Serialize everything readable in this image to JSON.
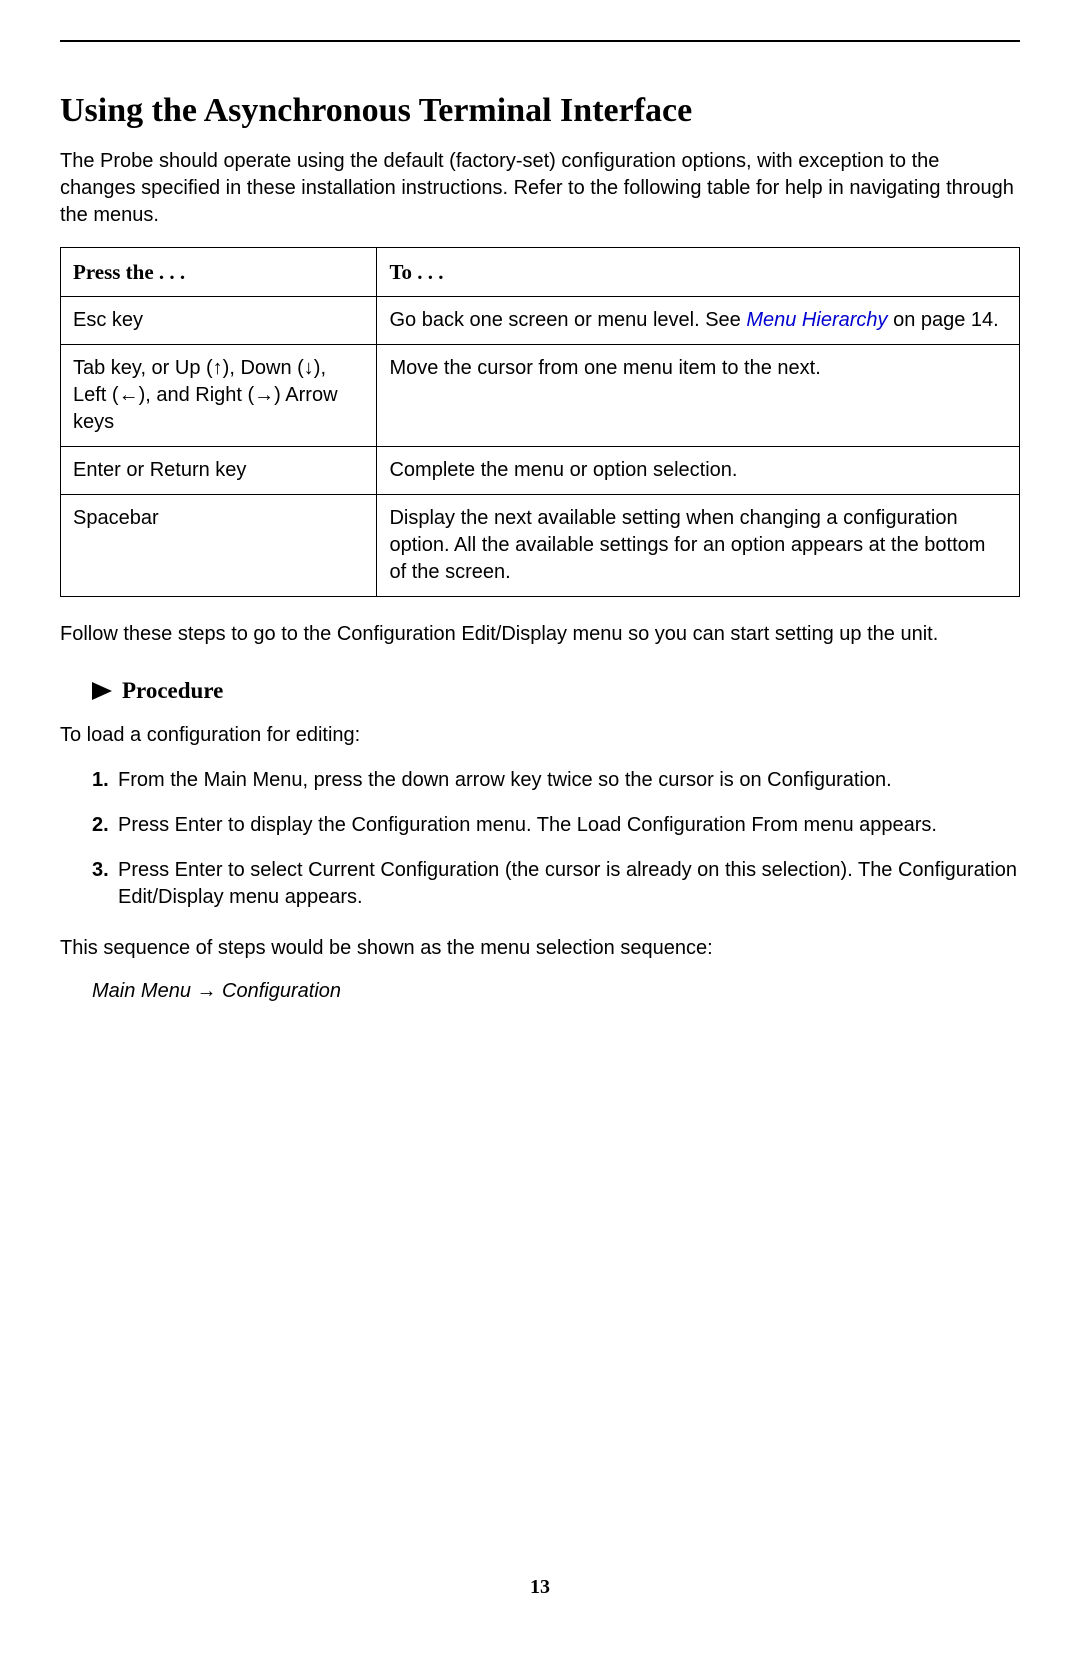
{
  "heading": "Using the Asynchronous Terminal Interface",
  "intro": "The Probe should operate using the default (factory-set) configuration options, with exception to the changes specified in these installation instructions. Refer to the following table for help in navigating through the menus.",
  "table": {
    "header_left": "Press the . . .",
    "header_right": "To . . .",
    "rows": [
      {
        "press": "Esc key",
        "to_prefix": "Go back one screen or menu level. See ",
        "to_link": "Menu Hierarchy",
        "to_suffix": " on page 14."
      },
      {
        "press": "Tab key, or Up (↑), Down (↓), Left (←), and Right (→) Arrow keys",
        "to": "Move the cursor from one menu item to the next."
      },
      {
        "press": "Enter or Return key",
        "to": "Complete the menu or option selection."
      },
      {
        "press": "Spacebar",
        "to": "Display the next available setting when changing a configuration option. All the available settings for an option appears at the bottom of the screen."
      }
    ]
  },
  "follow_steps": "Follow these steps to go to the Configuration Edit/Display menu so you can start setting up the unit.",
  "procedure": {
    "label": "Procedure",
    "intro": "To load a configuration for editing:",
    "steps": [
      {
        "num": "1.",
        "text": "From the Main Menu, press the down arrow key twice so the cursor is on Configuration."
      },
      {
        "num": "2.",
        "text": "Press Enter to display the Configuration menu. The Load Configuration From menu appears."
      },
      {
        "num": "3.",
        "text": "Press Enter to select Current Configuration (the cursor is already on this selection). The Configuration Edit/Display menu appears."
      }
    ]
  },
  "sequence_label": "This sequence of steps would be shown as the menu selection sequence:",
  "menu_path": "Main Menu → Configuration",
  "page_number": "13"
}
